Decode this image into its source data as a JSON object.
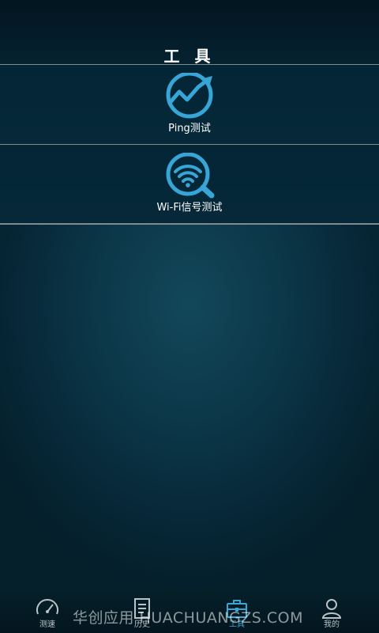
{
  "header": {
    "title": "工 具"
  },
  "tools": [
    {
      "label": "Ping测试",
      "icon": "ping-chart-icon"
    },
    {
      "label": "Wi-Fi信号测试",
      "icon": "wifi-search-icon"
    }
  ],
  "watermark": "华创应用 HUACHUANGZS.COM",
  "tabbar": {
    "active": "工具",
    "tabs": [
      {
        "label": "测速",
        "icon": "speedometer-icon"
      },
      {
        "label": "历史",
        "icon": "document-icon"
      },
      {
        "label": "工具",
        "icon": "toolbox-icon"
      },
      {
        "label": "我的",
        "icon": "user-icon"
      }
    ]
  },
  "colors": {
    "accent": "#3aa6d6",
    "background": "#0b3647"
  }
}
